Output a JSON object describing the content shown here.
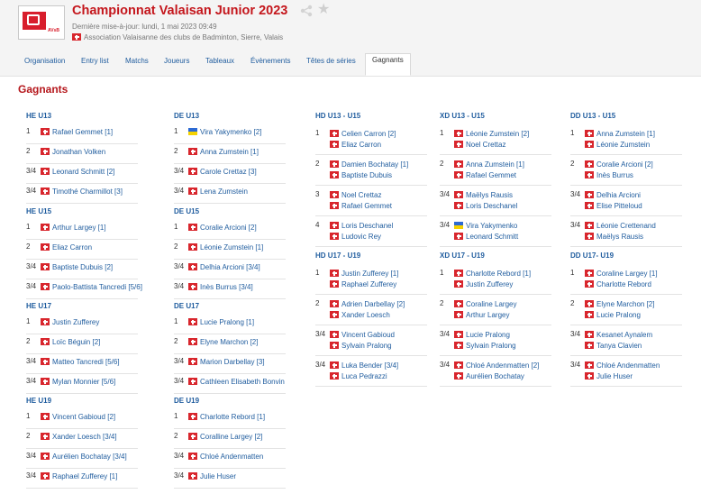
{
  "header": {
    "title": "Championnat Valaisan Junior 2023",
    "updated": "Dernière mise-à-jour: lundi, 1 mai 2023 09:49",
    "organization": "Association Valaisanne des clubs de Badminton, Sierre, Valais",
    "logo_text": "AVsB"
  },
  "tabs": [
    {
      "label": "Organisation"
    },
    {
      "label": "Entry list"
    },
    {
      "label": "Matchs"
    },
    {
      "label": "Joueurs"
    },
    {
      "label": "Tableaux"
    },
    {
      "label": "Évènements"
    },
    {
      "label": "Têtes de séries"
    },
    {
      "label": "Gagnants"
    }
  ],
  "active_tab": "Gagnants",
  "page_heading": "Gagnants",
  "colors": {
    "accent": "#c4161c",
    "link": "#1f5c9e",
    "flag_ch": "#d8262d"
  },
  "groups": [
    {
      "id": "he-u13",
      "title": "HE U13",
      "rows": [
        {
          "rank": "1",
          "players": [
            {
              "name": "Rafael Gemmet [1]",
              "flag": "ch"
            }
          ]
        },
        {
          "rank": "2",
          "players": [
            {
              "name": "Jonathan Volken",
              "flag": "ch"
            }
          ]
        },
        {
          "rank": "3/4",
          "players": [
            {
              "name": "Leonard Schmitt [2]",
              "flag": "ch"
            }
          ]
        },
        {
          "rank": "3/4",
          "players": [
            {
              "name": "Timothé Charmillot [3]",
              "flag": "ch"
            }
          ]
        }
      ]
    },
    {
      "id": "he-u15",
      "title": "HE U15",
      "rows": [
        {
          "rank": "1",
          "players": [
            {
              "name": "Arthur Largey [1]",
              "flag": "ch"
            }
          ]
        },
        {
          "rank": "2",
          "players": [
            {
              "name": "Eliaz Carron",
              "flag": "ch"
            }
          ]
        },
        {
          "rank": "3/4",
          "players": [
            {
              "name": "Baptiste Dubuis [2]",
              "flag": "ch"
            }
          ]
        },
        {
          "rank": "3/4",
          "players": [
            {
              "name": "Paolo-Battista Tancredi [5/6]",
              "flag": "ch"
            }
          ]
        }
      ]
    },
    {
      "id": "he-u17",
      "title": "HE U17",
      "rows": [
        {
          "rank": "1",
          "players": [
            {
              "name": "Justin Zufferey",
              "flag": "ch"
            }
          ]
        },
        {
          "rank": "2",
          "players": [
            {
              "name": "Loïc Béguin [2]",
              "flag": "ch"
            }
          ]
        },
        {
          "rank": "3/4",
          "players": [
            {
              "name": "Matteo Tancredi [5/6]",
              "flag": "ch"
            }
          ]
        },
        {
          "rank": "3/4",
          "players": [
            {
              "name": "Mylan Monnier [5/6]",
              "flag": "ch"
            }
          ]
        }
      ]
    },
    {
      "id": "he-u19",
      "title": "HE U19",
      "rows": [
        {
          "rank": "1",
          "players": [
            {
              "name": "Vincent Gabioud [2]",
              "flag": "ch"
            }
          ]
        },
        {
          "rank": "2",
          "players": [
            {
              "name": "Xander Loesch [3/4]",
              "flag": "ch"
            }
          ]
        },
        {
          "rank": "3/4",
          "players": [
            {
              "name": "Aurélien Bochatay [3/4]",
              "flag": "ch"
            }
          ]
        },
        {
          "rank": "3/4",
          "players": [
            {
              "name": "Raphael Zufferey [1]",
              "flag": "ch"
            }
          ]
        }
      ]
    },
    {
      "id": "de-u13",
      "title": "DE U13",
      "rows": [
        {
          "rank": "1",
          "players": [
            {
              "name": "Vira Yakymenko [2]",
              "flag": "ua"
            }
          ]
        },
        {
          "rank": "2",
          "players": [
            {
              "name": "Anna Zumstein [1]",
              "flag": "ch"
            }
          ]
        },
        {
          "rank": "3/4",
          "players": [
            {
              "name": "Carole Crettaz [3]",
              "flag": "ch"
            }
          ]
        },
        {
          "rank": "3/4",
          "players": [
            {
              "name": "Lena Zumstein",
              "flag": "ch"
            }
          ]
        }
      ]
    },
    {
      "id": "de-u15",
      "title": "DE U15",
      "rows": [
        {
          "rank": "1",
          "players": [
            {
              "name": "Coralie Arcioni [2]",
              "flag": "ch"
            }
          ]
        },
        {
          "rank": "2",
          "players": [
            {
              "name": "Léonie Zumstein [1]",
              "flag": "ch"
            }
          ]
        },
        {
          "rank": "3/4",
          "players": [
            {
              "name": "Delhia Arcioni [3/4]",
              "flag": "ch"
            }
          ]
        },
        {
          "rank": "3/4",
          "players": [
            {
              "name": "Inès Burrus [3/4]",
              "flag": "ch"
            }
          ]
        }
      ]
    },
    {
      "id": "de-u17",
      "title": "DE U17",
      "rows": [
        {
          "rank": "1",
          "players": [
            {
              "name": "Lucie Pralong [1]",
              "flag": "ch"
            }
          ]
        },
        {
          "rank": "2",
          "players": [
            {
              "name": "Elyne Marchon [2]",
              "flag": "ch"
            }
          ]
        },
        {
          "rank": "3/4",
          "players": [
            {
              "name": "Marion Darbellay [3]",
              "flag": "ch"
            }
          ]
        },
        {
          "rank": "3/4",
          "players": [
            {
              "name": "Cathleen Elisabeth Bonvin",
              "flag": "ch"
            }
          ]
        }
      ]
    },
    {
      "id": "de-u19",
      "title": "DE U19",
      "rows": [
        {
          "rank": "1",
          "players": [
            {
              "name": "Charlotte Rebord [1]",
              "flag": "ch"
            }
          ]
        },
        {
          "rank": "2",
          "players": [
            {
              "name": "Coralline Largey [2]",
              "flag": "ch"
            }
          ]
        },
        {
          "rank": "3/4",
          "players": [
            {
              "name": "Chloé Andenmatten",
              "flag": "ch"
            }
          ]
        },
        {
          "rank": "3/4",
          "players": [
            {
              "name": "Julie Huser",
              "flag": "ch"
            }
          ]
        }
      ]
    },
    {
      "id": "hd-u13-u15",
      "title": "HD U13 - U15",
      "rows": [
        {
          "rank": "1",
          "players": [
            {
              "name": "Celien Carron [2]",
              "flag": "ch"
            },
            {
              "name": "Eliaz Carron",
              "flag": "ch"
            }
          ]
        },
        {
          "rank": "2",
          "players": [
            {
              "name": "Damien Bochatay [1]",
              "flag": "ch"
            },
            {
              "name": "Baptiste Dubuis",
              "flag": "ch"
            }
          ]
        },
        {
          "rank": "3",
          "players": [
            {
              "name": "Noel Crettaz",
              "flag": "ch"
            },
            {
              "name": "Rafael Gemmet",
              "flag": "ch"
            }
          ]
        },
        {
          "rank": "4",
          "players": [
            {
              "name": "Loris Deschanel",
              "flag": "ch"
            },
            {
              "name": "Ludovic Rey",
              "flag": "ch"
            }
          ]
        }
      ]
    },
    {
      "id": "hd-u17-u19",
      "title": "HD U17 - U19",
      "rows": [
        {
          "rank": "1",
          "players": [
            {
              "name": "Justin Zufferey [1]",
              "flag": "ch"
            },
            {
              "name": "Raphael Zufferey",
              "flag": "ch"
            }
          ]
        },
        {
          "rank": "2",
          "players": [
            {
              "name": "Adrien Darbellay [2]",
              "flag": "ch"
            },
            {
              "name": "Xander Loesch",
              "flag": "ch"
            }
          ]
        },
        {
          "rank": "3/4",
          "players": [
            {
              "name": "Vincent Gabioud",
              "flag": "ch"
            },
            {
              "name": "Sylvain Pralong",
              "flag": "ch"
            }
          ]
        },
        {
          "rank": "3/4",
          "players": [
            {
              "name": "Luka Bender [3/4]",
              "flag": "ch"
            },
            {
              "name": "Luca Pedrazzi",
              "flag": "ch"
            }
          ]
        }
      ]
    },
    {
      "id": "xd-u13-u15",
      "title": "XD U13 - U15",
      "rows": [
        {
          "rank": "1",
          "players": [
            {
              "name": "Léonie Zumstein [2]",
              "flag": "ch"
            },
            {
              "name": "Noel Crettaz",
              "flag": "ch"
            }
          ]
        },
        {
          "rank": "2",
          "players": [
            {
              "name": "Anna Zumstein [1]",
              "flag": "ch"
            },
            {
              "name": "Rafael Gemmet",
              "flag": "ch"
            }
          ]
        },
        {
          "rank": "3/4",
          "players": [
            {
              "name": "Maëlys Rausis",
              "flag": "ch"
            },
            {
              "name": "Loris Deschanel",
              "flag": "ch"
            }
          ]
        },
        {
          "rank": "3/4",
          "players": [
            {
              "name": "Vira Yakymenko",
              "flag": "ua"
            },
            {
              "name": "Leonard Schmitt",
              "flag": "ch"
            }
          ]
        }
      ]
    },
    {
      "id": "xd-u17-u19",
      "title": "XD U17 - U19",
      "rows": [
        {
          "rank": "1",
          "players": [
            {
              "name": "Charlotte Rebord [1]",
              "flag": "ch"
            },
            {
              "name": "Justin Zufferey",
              "flag": "ch"
            }
          ]
        },
        {
          "rank": "2",
          "players": [
            {
              "name": "Coraline Largey",
              "flag": "ch"
            },
            {
              "name": "Arthur Largey",
              "flag": "ch"
            }
          ]
        },
        {
          "rank": "3/4",
          "players": [
            {
              "name": "Lucie Pralong",
              "flag": "ch"
            },
            {
              "name": "Sylvain Pralong",
              "flag": "ch"
            }
          ]
        },
        {
          "rank": "3/4",
          "players": [
            {
              "name": "Chloé Andenmatten [2]",
              "flag": "ch"
            },
            {
              "name": "Aurélien Bochatay",
              "flag": "ch"
            }
          ]
        }
      ]
    },
    {
      "id": "dd-u13-u15",
      "title": "DD U13 - U15",
      "rows": [
        {
          "rank": "1",
          "players": [
            {
              "name": "Anna Zumstein [1]",
              "flag": "ch"
            },
            {
              "name": "Léonie Zumstein",
              "flag": "ch"
            }
          ]
        },
        {
          "rank": "2",
          "players": [
            {
              "name": "Coralie Arcioni [2]",
              "flag": "ch"
            },
            {
              "name": "Inès Burrus",
              "flag": "ch"
            }
          ]
        },
        {
          "rank": "3/4",
          "players": [
            {
              "name": "Delhia Arcioni",
              "flag": "ch"
            },
            {
              "name": "Elise Pitteloud",
              "flag": "ch"
            }
          ]
        },
        {
          "rank": "3/4",
          "players": [
            {
              "name": "Léonie Crettenand",
              "flag": "ch"
            },
            {
              "name": "Maëlys Rausis",
              "flag": "ch"
            }
          ]
        }
      ]
    },
    {
      "id": "dd-u17-u19",
      "title": "DD U17- U19",
      "rows": [
        {
          "rank": "1",
          "players": [
            {
              "name": "Coraline Largey [1]",
              "flag": "ch"
            },
            {
              "name": "Charlotte Rebord",
              "flag": "ch"
            }
          ]
        },
        {
          "rank": "2",
          "players": [
            {
              "name": "Elyne Marchon [2]",
              "flag": "ch"
            },
            {
              "name": "Lucie Pralong",
              "flag": "ch"
            }
          ]
        },
        {
          "rank": "3/4",
          "players": [
            {
              "name": "Kesanet Aynalem",
              "flag": "ch"
            },
            {
              "name": "Tanya Clavien",
              "flag": "ch"
            }
          ]
        },
        {
          "rank": "3/4",
          "players": [
            {
              "name": "Chloé Andenmatten",
              "flag": "ch"
            },
            {
              "name": "Julie Huser",
              "flag": "ch"
            }
          ]
        }
      ]
    }
  ]
}
